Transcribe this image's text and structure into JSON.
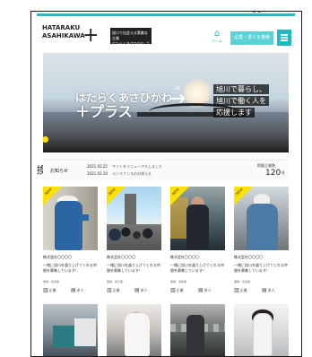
{
  "artifacts": {
    "corner_text": "ᵕᵕ",
    "side_text": "換"
  },
  "header": {
    "logo_line1": "HATARAKU",
    "logo_line2": "ASAHIKAWA",
    "logo_plus": "+",
    "tag_line1": "旭川で出会える素敵な企業",
    "tag_line2": "はたらくあさひかわ プラス",
    "home_label": "ホーム",
    "cta_label": "企業・求人を検索",
    "menu_label": "≡"
  },
  "hero": {
    "title_line1": "はたらくあさひかわ",
    "title_line2": "＋プラス",
    "arrow": "→",
    "arrow_caption": "は",
    "right_line1": "旭川で暮らし、",
    "right_line2": "旭川で働く人を",
    "right_line3": "応援します"
  },
  "news": {
    "label": "お知らせ",
    "items": [
      {
        "date": "2021.03.25",
        "text": "サイトをリニューアルしました"
      },
      {
        "date": "2021.03.10",
        "text": "メンテナンスのお知らせ"
      }
    ],
    "count_label": "掲載企業数",
    "count_value": "120",
    "count_unit": "社"
  },
  "cards": [
    {
      "badge": "NEW",
      "company": "株式会社〇〇〇〇",
      "text": "一緒に旭川を盛り上げてくれる仲間を募集しています！",
      "meta": "業種：製造業",
      "action1": "企業",
      "action2": "求人"
    },
    {
      "badge": "NEW",
      "company": "株式会社〇〇〇〇",
      "text": "一緒に旭川を盛り上げてくれる仲間を募集しています！",
      "meta": "業種：観光業",
      "action1": "企業",
      "action2": "求人"
    },
    {
      "badge": "NEW",
      "company": "株式会社〇〇〇〇",
      "text": "一緒に旭川を盛り上げてくれる仲間を募集しています！",
      "meta": "業種：運輸業",
      "action1": "企業",
      "action2": "求人"
    },
    {
      "badge": "NEW",
      "company": "株式会社〇〇〇〇",
      "text": "一緒に旭川を盛り上げてくれる仲間を募集しています！",
      "meta": "業種：建設業",
      "action1": "企業",
      "action2": "求人"
    }
  ]
}
